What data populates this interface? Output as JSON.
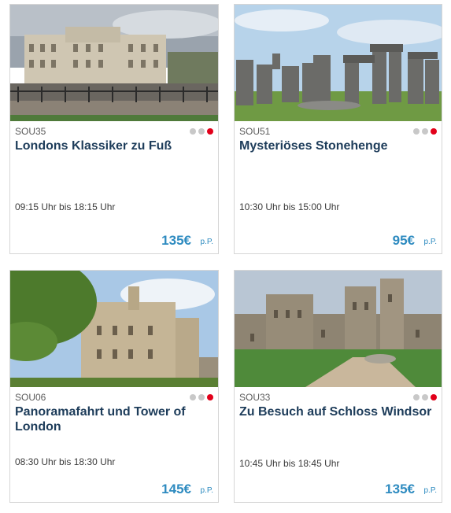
{
  "tours": [
    {
      "code": "SOU35",
      "title": "Londons Klassiker zu Fuß",
      "time": "09:15 Uhr bis 18:15 Uhr",
      "price": "135€",
      "per_person": "p.P.",
      "image": "buckingham-palace"
    },
    {
      "code": "SOU51",
      "title": "Mysteriöses Stonehenge",
      "time": "10:30 Uhr bis 15:00 Uhr",
      "price": "95€",
      "per_person": "p.P.",
      "image": "stonehenge"
    },
    {
      "code": "SOU06",
      "title": "Panoramafahrt und Tower of London",
      "time": "08:30 Uhr bis 18:30 Uhr",
      "price": "145€",
      "per_person": "p.P.",
      "image": "tower-of-london"
    },
    {
      "code": "SOU33",
      "title": "Zu Besuch auf Schloss Windsor",
      "time": "10:45 Uhr bis 18:45 Uhr",
      "price": "135€",
      "per_person": "p.P.",
      "image": "windsor-castle"
    }
  ],
  "colors": {
    "accent_price": "#2e8bc0",
    "title": "#1d3c5a",
    "dot_active": "#e2001a",
    "dot_inactive": "#c8c8c8"
  }
}
